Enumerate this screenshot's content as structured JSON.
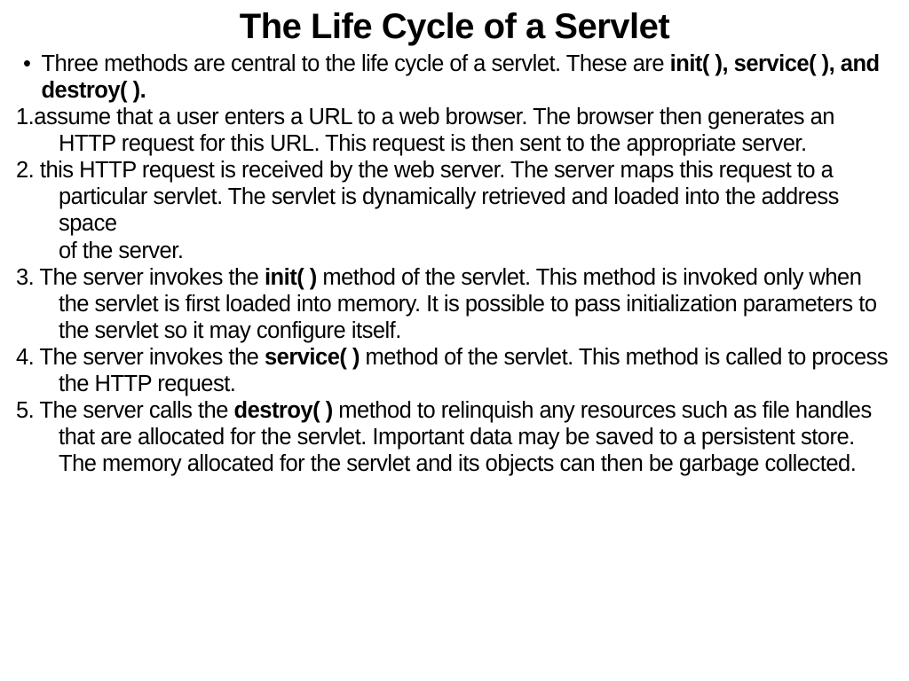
{
  "title": "The Life Cycle of a Servlet",
  "bullet": {
    "pre": "Three methods are central to the life cycle of a servlet. These are ",
    "bold": "init( ),  service( ),  and destroy( )."
  },
  "p1": {
    "num": "1.",
    "text": "assume that a user enters a URL to a web browser. The browser then generates an HTTP request for this URL. This request is then sent to the appropriate server."
  },
  "p2": {
    "num": "2.",
    "text": " this HTTP request is received by the web server. The server maps this request to a particular servlet. The servlet is dynamically retrieved and loaded into the address space",
    "sub": " of the server."
  },
  "p3": {
    "num": "3.",
    "pre": " The server invokes the ",
    "bold": "init( )",
    "post": " method of the servlet. This method is invoked only when the servlet is first loaded into memory. It is possible to pass initialization parameters to the servlet so it may configure itself."
  },
  "p4": {
    "num": "4.",
    "pre": " The server invokes the ",
    "bold": "service( )",
    "post": " method of the servlet. This method is called to process the HTTP request."
  },
  "p5": {
    "num": "5.",
    "pre": " The server calls the ",
    "bold": "destroy( )",
    "post": " method to relinquish any resources such as file handles that are allocated for the servlet. Important data may be saved to a persistent store. The memory allocated for the servlet and its objects can then be garbage collected."
  }
}
